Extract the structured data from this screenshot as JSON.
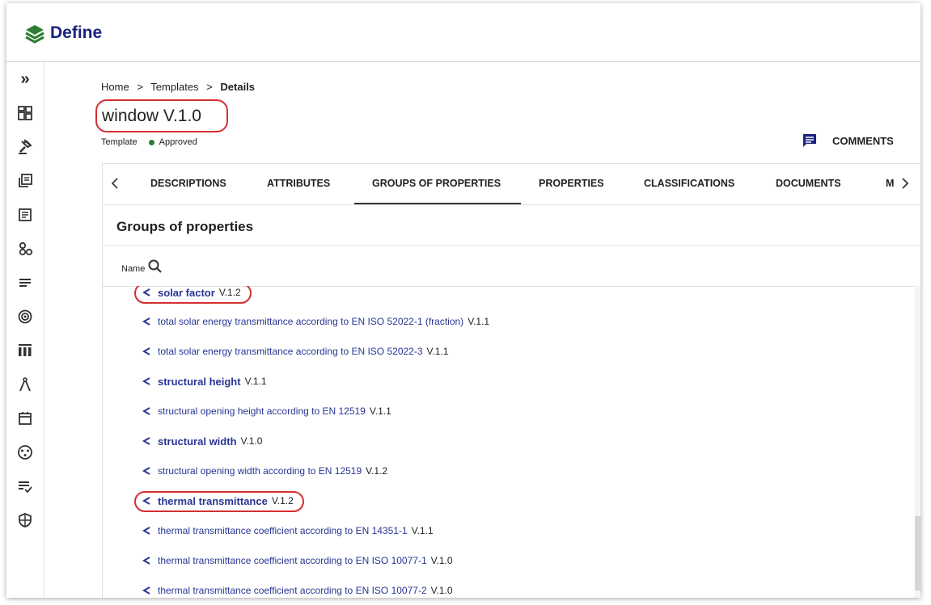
{
  "app": {
    "name": "Define"
  },
  "breadcrumb": {
    "home": "Home",
    "templates": "Templates",
    "current": "Details",
    "sep": ">"
  },
  "title": "window V.1.0",
  "meta": {
    "type": "Template",
    "status": "Approved",
    "status_color": "#2e7d32"
  },
  "comments_label": "COMMENTS",
  "sidebar": {
    "expand": "»",
    "icons": [
      "dashboard-icon",
      "gavel-icon",
      "library-icon",
      "article-icon",
      "groups-icon",
      "list-icon",
      "target-icon",
      "columns-icon",
      "compass-icon",
      "calendar-icon",
      "network-icon",
      "checklist-icon",
      "shield-icon"
    ]
  },
  "tabs": [
    "DESCRIPTIONS",
    "ATTRIBUTES",
    "GROUPS OF PROPERTIES",
    "PROPERTIES",
    "CLASSIFICATIONS",
    "DOCUMENTS",
    "M"
  ],
  "active_tab": "GROUPS OF PROPERTIES",
  "section_title": "Groups of properties",
  "list_header": {
    "name": "Name"
  },
  "items": [
    {
      "name": "solar factor",
      "version": "V.1.2",
      "bold": true,
      "highlighted": true
    },
    {
      "name": "total solar energy transmittance according to EN ISO 52022-1 (fraction)",
      "version": "V.1.1",
      "bold": false
    },
    {
      "name": "total solar energy transmittance according to EN ISO 52022-3",
      "version": "V.1.1",
      "bold": false
    },
    {
      "name": "structural height",
      "version": "V.1.1",
      "bold": true
    },
    {
      "name": "structural opening height according to EN 12519",
      "version": "V.1.1",
      "bold": false
    },
    {
      "name": "structural width",
      "version": "V.1.0",
      "bold": true
    },
    {
      "name": "structural opening width according to EN 12519",
      "version": "V.1.2",
      "bold": false
    },
    {
      "name": "thermal transmittance",
      "version": "V.1.2",
      "bold": true,
      "highlighted": true
    },
    {
      "name": "thermal transmittance coefficient according to EN 14351-1",
      "version": "V.1.1",
      "bold": false
    },
    {
      "name": "thermal transmittance coefficient according to EN ISO 10077-1",
      "version": "V.1.0",
      "bold": false
    },
    {
      "name": "thermal transmittance coefficient according to EN ISO 10077-2",
      "version": "V.1.0",
      "bold": false
    }
  ],
  "colors": {
    "accent": "#1a237e",
    "link": "#283593",
    "highlight": "#d32f2f"
  }
}
